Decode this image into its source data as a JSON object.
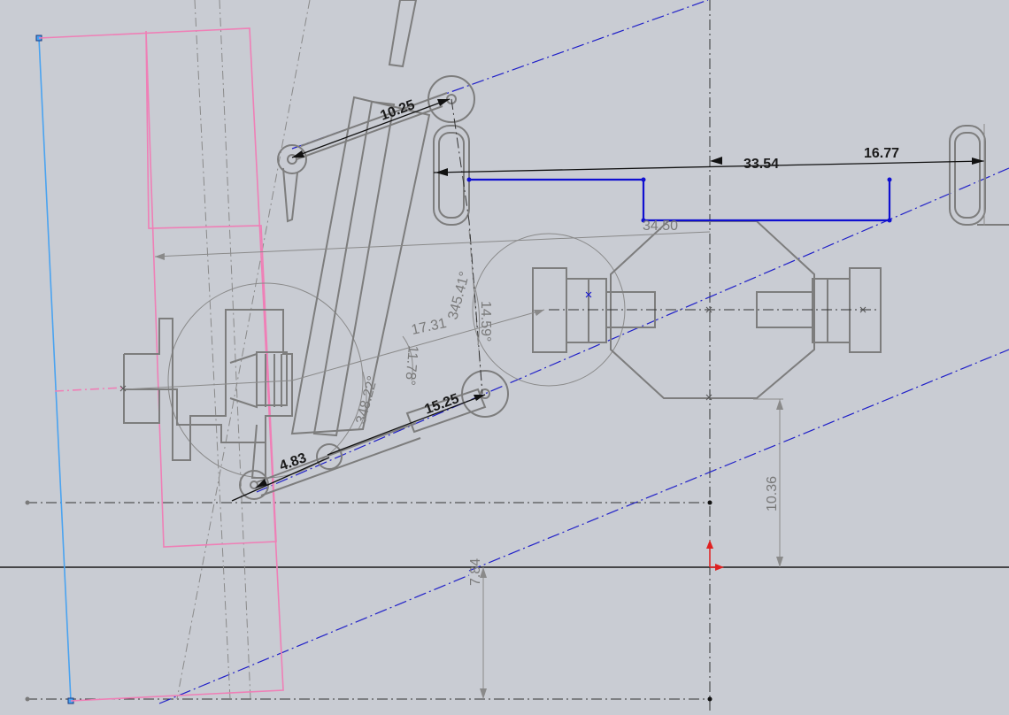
{
  "viewport": {
    "background": "#c9ccd3"
  },
  "colors": {
    "geometry": "#7d7d7d",
    "construction_pink": "#ef7fb6",
    "construction_blue": "#2020c8",
    "selected_blue": "#1010d0",
    "reference_line_blue": "#4aa3f0",
    "dimension_dark": "#1a1a1a",
    "dimension_gray": "#7a7a7a",
    "origin_red": "#e02020"
  },
  "dimensions": {
    "d_10_25": "10.25",
    "d_33_54": "33.54",
    "d_16_77": "16.77",
    "d_34_50": "34.50",
    "d_17_31": "17.31",
    "d_345_41": "345.41°",
    "d_14_59": "14.59°",
    "d_11_78": "11.78°",
    "d_348_22": "348.22°",
    "d_15_25": "15.25",
    "d_4_83": "4.83",
    "d_10_36": "10.36",
    "d_7_84": "7.84"
  },
  "icons": {
    "origin": "origin-axes-icon",
    "sketch_point": "sketch-point-icon",
    "endpoint": "endpoint-handle-icon"
  }
}
